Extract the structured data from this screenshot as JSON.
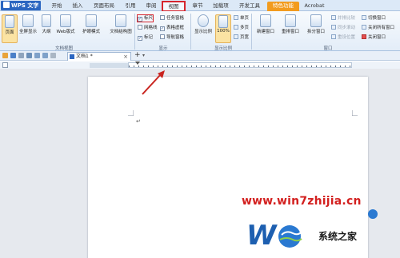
{
  "app": {
    "menu_label": "WPS 文字"
  },
  "tabs": [
    {
      "label": "开始"
    },
    {
      "label": "插入"
    },
    {
      "label": "页面布局"
    },
    {
      "label": "引用"
    },
    {
      "label": "审阅"
    },
    {
      "label": "视图"
    },
    {
      "label": "章节"
    },
    {
      "label": "加载项"
    },
    {
      "label": "开发工具"
    },
    {
      "label": "特色功能"
    },
    {
      "label": "Acrobat"
    }
  ],
  "ribbon": {
    "doc_views": {
      "group_label": "文档视图",
      "page": "页面",
      "fullscreen": "全屏显示",
      "outline": "大纲",
      "web": "Web版式",
      "reading": "护眼模式",
      "doc_map": "文档结构图"
    },
    "show": {
      "group_label": "显示",
      "ruler": "标尺",
      "gridlines": "网格线",
      "marks": "标记",
      "taskpane": "任务窗格",
      "table_borders": "表格虚框",
      "nav_pane": "导航窗格"
    },
    "zoom": {
      "group_label": "显示比例",
      "zoom": "显示比例",
      "percent": "100%",
      "single": "单页",
      "multi": "多页",
      "width": "页宽"
    },
    "window": {
      "group_label": "窗口",
      "new_window": "新建窗口",
      "arrange": "重排窗口",
      "split": "拆分窗口",
      "side_by_side": "并排比较",
      "sync_scroll": "同步滚动",
      "reset_pos": "重设位置",
      "switch": "切换窗口",
      "close_all": "关闭所有窗口",
      "close": "关闭窗口"
    }
  },
  "document": {
    "tab_title": "文档1 *",
    "cursor": "↵"
  },
  "watermark": {
    "url": "www.win7zhijia.cn",
    "site": "系统之家"
  }
}
